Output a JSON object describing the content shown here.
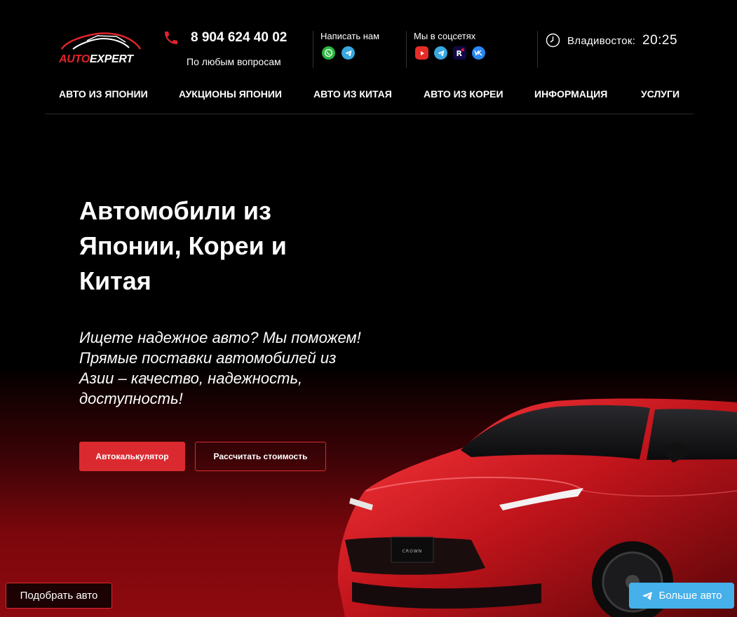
{
  "header": {
    "logo": {
      "part1": "AUTO",
      "part2": "EXPERT"
    },
    "phone": "8 904 624 40 02",
    "phone_sub": "По любым вопросам",
    "write_label": "Написать нам",
    "social_label": "Мы в соцсетях",
    "messengers": [
      "whatsapp-icon",
      "telegram-icon"
    ],
    "socials": [
      "youtube-icon",
      "telegram-icon",
      "rutube-icon",
      "vk-icon"
    ],
    "city": "Владивосток:",
    "time": "20:25"
  },
  "nav": {
    "items": [
      "АВТО ИЗ ЯПОНИИ",
      "АУКЦИОНЫ ЯПОНИИ",
      "АВТО ИЗ КИТАЯ",
      "АВТО ИЗ КОРЕИ",
      "ИНФОРМАЦИЯ",
      "УСЛУГИ"
    ]
  },
  "hero": {
    "title_lines": [
      "Автомобили из",
      "Японии, Кореи и",
      "Китая"
    ],
    "subtitle_lines": [
      "Ищете надежное авто? Мы поможем!",
      "Прямые поставки автомобилей из",
      "Азии – качество, надежность,",
      "доступность!"
    ],
    "calc_button": "Автокалькулятор",
    "price_button": "Рассчитать стоимость",
    "car_badge": "CROWN"
  },
  "floating": {
    "pick_car": "Подобрать авто",
    "more_cars": "Больше авто"
  },
  "colors": {
    "accent": "#da2a2f",
    "telegram": "#45b0ea",
    "background": "#000000"
  }
}
